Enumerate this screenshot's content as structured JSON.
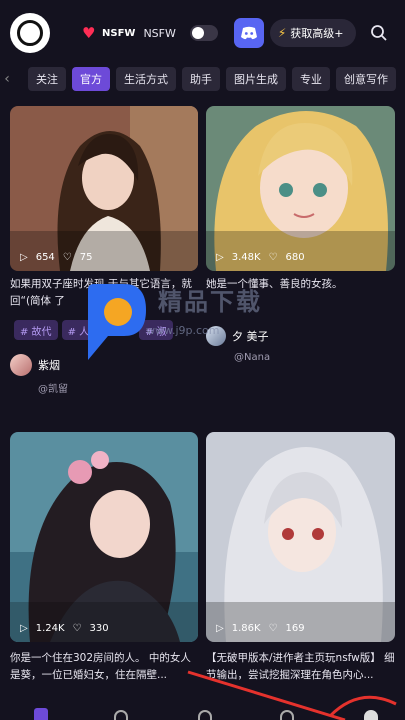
{
  "header": {
    "nsfw_badge": "NSFW",
    "nsfw_label": "NSFW",
    "premium_label": "获取高级+"
  },
  "tabs": [
    "关注",
    "官方",
    "生活方式",
    "助手",
    "图片生成",
    "专业",
    "创意写作"
  ],
  "active_tab": 1,
  "cards": [
    {
      "views": "654",
      "likes": "75",
      "caption": "如果用双子座时发现 于与其它语言，就回“(简体 了",
      "tags": [
        "# 故代",
        "# 人",
        "# 淑"
      ],
      "author": "紫烟",
      "handle": "@凯留"
    },
    {
      "views": "3.48K",
      "likes": "680",
      "caption": "她是一个懂事、善良的女孩。",
      "author": "夕 美子",
      "handle": "@Nana"
    },
    {
      "views": "1.24K",
      "likes": "330",
      "caption": "你是一个住在302房间的人。 中的女人是葵，一位已婚妇女，住在隔壁..."
    },
    {
      "views": "1.86K",
      "likes": "169",
      "caption": "【无破甲版本/进作者主页玩nsfw版】 细节输出，尝试挖掘深理在角色内心..."
    }
  ],
  "watermark": {
    "text": "精品下载",
    "url": "www.j9p.com"
  },
  "colors": {
    "background": "#14121f",
    "accent": "#6d4ad8",
    "discord": "#5865f2",
    "tag_bg": "#3a2a5e",
    "tag_text": "#b49af2"
  }
}
